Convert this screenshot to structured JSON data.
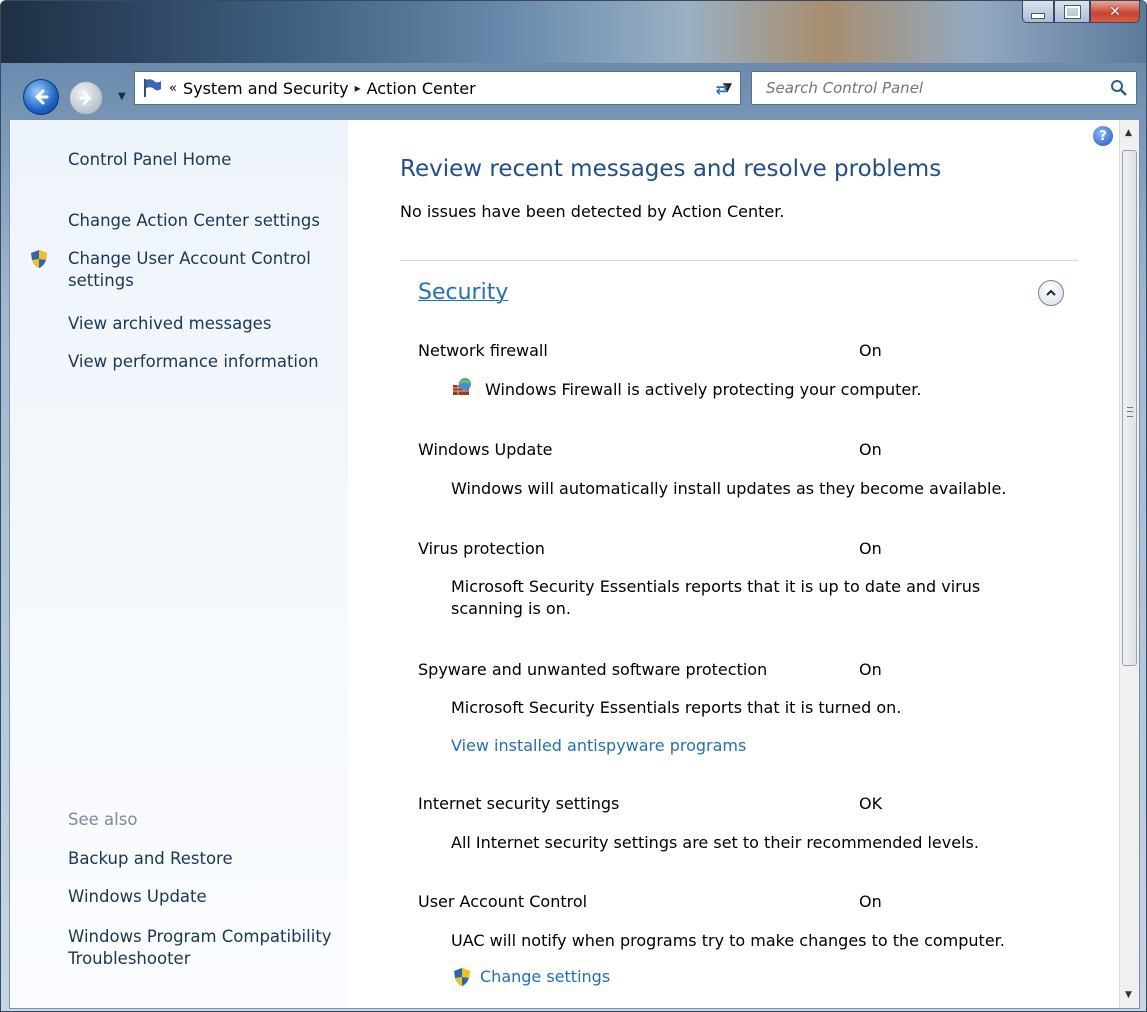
{
  "window": {
    "caption": {
      "minimize": "minimize-icon",
      "maximize": "maximize-icon",
      "close": "close-icon"
    }
  },
  "address": {
    "prefix": "«",
    "crumbs": [
      "System and Security",
      "Action Center"
    ],
    "separator": "▸"
  },
  "search": {
    "placeholder": "Search Control Panel"
  },
  "sidebar": {
    "items": [
      "Control Panel Home",
      "Change Action Center settings",
      "Change User Account Control settings",
      "View archived messages",
      "View performance information"
    ],
    "see_also_label": "See also",
    "see_also": [
      "Backup and Restore",
      "Windows Update",
      "Windows Program Compatibility Troubleshooter"
    ]
  },
  "main": {
    "title": "Review recent messages and resolve problems",
    "subtitle": "No issues have been detected by Action Center.",
    "section": "Security",
    "rows": [
      {
        "name": "Network firewall",
        "status": "On",
        "desc": "Windows Firewall is actively protecting your computer."
      },
      {
        "name": "Windows Update",
        "status": "On",
        "desc": "Windows will automatically install updates as they become available."
      },
      {
        "name": "Virus protection",
        "status": "On",
        "desc": "Microsoft Security Essentials reports that it is up to date and virus scanning is on."
      },
      {
        "name": "Spyware and unwanted software protection",
        "status": "On",
        "desc": "Microsoft Security Essentials reports that it is turned on.",
        "link": "View installed antispyware programs"
      },
      {
        "name": "Internet security settings",
        "status": "OK",
        "desc": "All Internet security settings are set to their recommended levels."
      },
      {
        "name": "User Account Control",
        "status": "On",
        "desc": "UAC will notify when programs try to make changes to the computer.",
        "link": "Change settings"
      }
    ]
  },
  "colors": {
    "link": "#1f6fbf",
    "heading": "#1f4e8c",
    "nav_text": "#1a3658"
  }
}
